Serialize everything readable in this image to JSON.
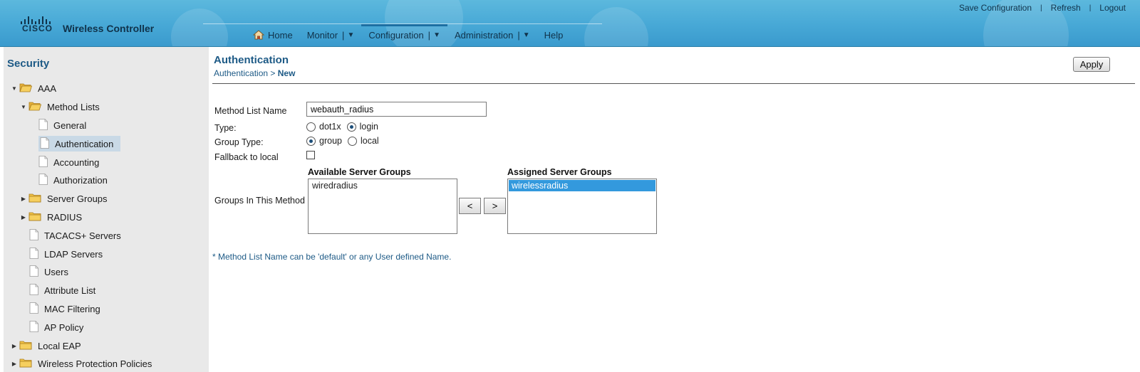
{
  "header": {
    "brand": "CISCO",
    "product": "Wireless Controller",
    "top_links": [
      "Save Configuration",
      "Refresh",
      "Logout"
    ],
    "nav": [
      {
        "label": "Home",
        "icon": "home-icon",
        "has_menu": false
      },
      {
        "label": "Monitor",
        "has_menu": true
      },
      {
        "label": "Configuration",
        "has_menu": true,
        "active": true
      },
      {
        "label": "Administration",
        "has_menu": true
      },
      {
        "label": "Help",
        "has_menu": false
      }
    ]
  },
  "sidebar": {
    "title": "Security",
    "items": [
      {
        "label": "AAA",
        "level": 0,
        "icon": "folder-open-icon",
        "twisty": "expanded"
      },
      {
        "label": "Method Lists",
        "level": 1,
        "icon": "folder-open-icon",
        "twisty": "expanded"
      },
      {
        "label": "General",
        "level": 2,
        "icon": "page-icon"
      },
      {
        "label": "Authentication",
        "level": 2,
        "icon": "page-icon",
        "selected": true
      },
      {
        "label": "Accounting",
        "level": 2,
        "icon": "page-icon"
      },
      {
        "label": "Authorization",
        "level": 2,
        "icon": "page-icon"
      },
      {
        "label": "Server Groups",
        "level": 1,
        "icon": "folder-icon",
        "twisty": "collapsed"
      },
      {
        "label": "RADIUS",
        "level": 1,
        "icon": "folder-icon",
        "twisty": "collapsed"
      },
      {
        "label": "TACACS+ Servers",
        "level": 1,
        "icon": "page-icon"
      },
      {
        "label": "LDAP Servers",
        "level": 1,
        "icon": "page-icon"
      },
      {
        "label": "Users",
        "level": 1,
        "icon": "page-icon"
      },
      {
        "label": "Attribute List",
        "level": 1,
        "icon": "page-icon"
      },
      {
        "label": "MAC Filtering",
        "level": 1,
        "icon": "page-icon"
      },
      {
        "label": "AP Policy",
        "level": 1,
        "icon": "page-icon"
      },
      {
        "label": "Local EAP",
        "level": 0,
        "icon": "folder-icon",
        "twisty": "collapsed"
      },
      {
        "label": "Wireless Protection Policies",
        "level": 0,
        "icon": "folder-icon",
        "twisty": "collapsed"
      }
    ]
  },
  "main": {
    "title": "Authentication",
    "breadcrumb_parent": "Authentication",
    "breadcrumb_sep": ">",
    "breadcrumb_current": "New",
    "apply_label": "Apply",
    "form": {
      "method_list_name_label": "Method List Name",
      "method_list_name_value": "webauth_radius",
      "type_label": "Type:",
      "type_options": [
        "dot1x",
        "login"
      ],
      "type_selected": "login",
      "group_type_label": "Group Type:",
      "group_type_options": [
        "group",
        "local"
      ],
      "group_type_selected": "group",
      "fallback_label": "Fallback to local",
      "fallback_checked": false,
      "groups_label": "Groups In This Method",
      "available_header": "Available Server Groups",
      "available_items": [
        "wiredradius"
      ],
      "assigned_header": "Assigned Server Groups",
      "assigned_items": [
        "wirelessradius"
      ],
      "move_left_label": "<",
      "move_right_label": ">"
    },
    "note": "* Method List Name can be 'default' or any User defined Name."
  }
}
